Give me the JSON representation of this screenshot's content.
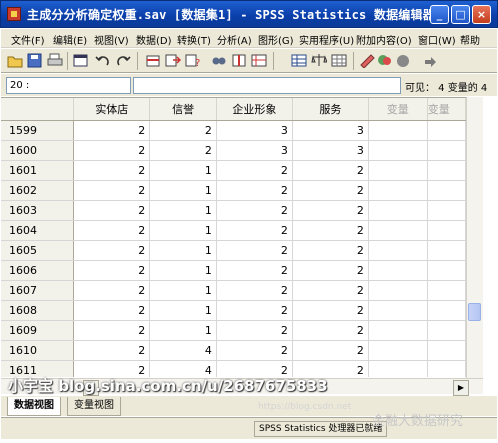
{
  "window": {
    "title": "主成分分析确定权重.sav [数据集1] - SPSS Statistics 数据编辑器",
    "minimize_label": "_",
    "maximize_label": "□",
    "close_label": "×"
  },
  "menu": [
    "文件(F)",
    "编辑(E)",
    "视图(V)",
    "数据(D)",
    "转换(T)",
    "分析(A)",
    "图形(G)",
    "实用程序(U)",
    "附加内容(O)",
    "窗口(W)",
    "帮助"
  ],
  "toolbar_icons": [
    "open-icon",
    "save-icon",
    "print-icon",
    "dialog-recall-icon",
    "undo-icon",
    "redo-icon",
    "goto-case-icon",
    "insert-cases-icon",
    "goto-variable-icon",
    "find-icon",
    "insert-variable-icon",
    "split-file-icon",
    "weight-cases-icon",
    "select-cases-icon",
    "value-labels-icon",
    "use-sets-icon",
    "show-all-icon",
    "spell-icon"
  ],
  "cellbar": {
    "ref": "20 :",
    "visible": "可见： 4 变量的 4"
  },
  "grid": {
    "columns": [
      "实体店",
      "信誉",
      "企业形象",
      "服务",
      "变量",
      "变量"
    ],
    "rows": [
      {
        "id": "1599",
        "values": [
          "2",
          "2",
          "3",
          "3"
        ]
      },
      {
        "id": "1600",
        "values": [
          "2",
          "2",
          "3",
          "3"
        ]
      },
      {
        "id": "1601",
        "values": [
          "2",
          "1",
          "2",
          "2"
        ]
      },
      {
        "id": "1602",
        "values": [
          "2",
          "1",
          "2",
          "2"
        ]
      },
      {
        "id": "1603",
        "values": [
          "2",
          "1",
          "2",
          "2"
        ]
      },
      {
        "id": "1604",
        "values": [
          "2",
          "1",
          "2",
          "2"
        ]
      },
      {
        "id": "1605",
        "values": [
          "2",
          "1",
          "2",
          "2"
        ]
      },
      {
        "id": "1606",
        "values": [
          "2",
          "1",
          "2",
          "2"
        ]
      },
      {
        "id": "1607",
        "values": [
          "2",
          "1",
          "2",
          "2"
        ]
      },
      {
        "id": "1608",
        "values": [
          "2",
          "1",
          "2",
          "2"
        ]
      },
      {
        "id": "1609",
        "values": [
          "2",
          "1",
          "2",
          "2"
        ]
      },
      {
        "id": "1610",
        "values": [
          "2",
          "4",
          "2",
          "2"
        ]
      },
      {
        "id": "1611",
        "values": [
          "2",
          "4",
          "2",
          "2"
        ]
      }
    ]
  },
  "tabs": {
    "data_view": "数据视图",
    "variable_view": "变量视图"
  },
  "status": "SPSS Statistics 处理器已就绪",
  "watermarks": {
    "blog": "小宇宝 blog.sina.com.cn/u/2687675833",
    "wechat": "金融大数据研究",
    "url": "https://blog.csdn.net"
  },
  "colors": {
    "titlebar": "#0a3ea8",
    "chrome": "#ece9d8",
    "header": "#f2f1ea"
  }
}
